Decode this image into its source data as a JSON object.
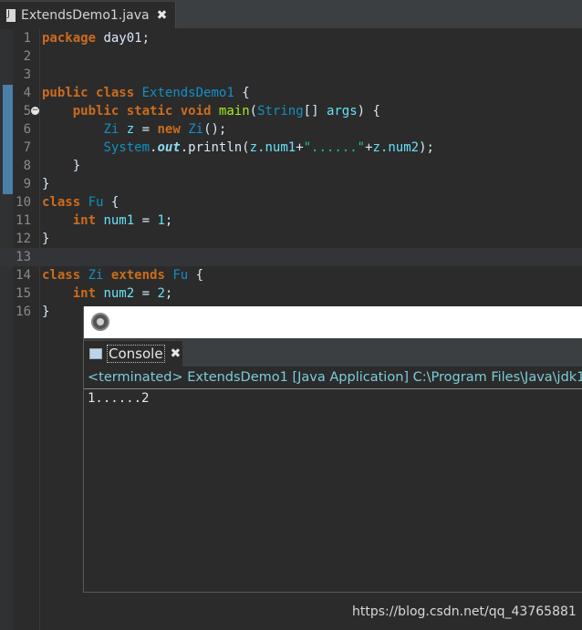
{
  "editor_tab": {
    "title": "ExtendsDemo1.java",
    "close": "✖"
  },
  "line_numbers": [
    "1",
    "2",
    "3",
    "4",
    "5",
    "6",
    "7",
    "8",
    "9",
    "10",
    "11",
    "12",
    "13",
    "14",
    "15",
    "16"
  ],
  "code": {
    "l1_kw": "package",
    "l1_rest": " day01;",
    "l4_kw1": "public",
    "l4_kw2": "class",
    "l4_cls": "ExtendsDemo1",
    "l4_rest": " {",
    "l5_kw1": "public",
    "l5_kw2": "static",
    "l5_kw3": "void",
    "l5_mth": "main",
    "l5_p1": "(",
    "l5_cls": "String",
    "l5_p2": "[] ",
    "l5_var": "args",
    "l5_p3": ") {",
    "l6_cls1": "Zi",
    "l6_var": "z",
    "l6_eq": " = ",
    "l6_kw": "new",
    "l6_cls2": "Zi",
    "l6_rest": "();",
    "l7_cls": "System",
    "l7_dot1": ".",
    "l7_st": "out",
    "l7_dot2": ".println(",
    "l7_var1": "z.num1",
    "l7_plus1": "+",
    "l7_str": "\"......\"",
    "l7_plus2": "+",
    "l7_var2": "z.num2",
    "l7_end": ");",
    "l8": "}",
    "l9": "}",
    "l10_kw": "class",
    "l10_cls": "Fu",
    "l10_rest": " {",
    "l11_kw": "int",
    "l11_var": "num1",
    "l11_rest": " = ",
    "l11_num": "1",
    "l11_end": ";",
    "l12": "}",
    "l14_kw1": "class",
    "l14_cls1": "Zi",
    "l14_kw2": "extends",
    "l14_cls2": "Fu",
    "l14_rest": " {",
    "l15_kw": "int",
    "l15_var": "num2",
    "l15_rest": " = ",
    "l15_num": "2",
    "l15_end": ";",
    "l16": "}"
  },
  "console": {
    "tab_title": "Console",
    "tab_close": "✖",
    "status": "<terminated> ExtendsDemo1 [Java Application] C:\\Program Files\\Java\\jdk1",
    "output": "1......2"
  },
  "watermark": "https://blog.csdn.net/qq_43765881",
  "colors": {
    "keyword": "#cc6c1d",
    "class": "#1290c3",
    "variable": "#66e1f8",
    "string": "#17c6a3",
    "background": "#2b2b2b"
  }
}
